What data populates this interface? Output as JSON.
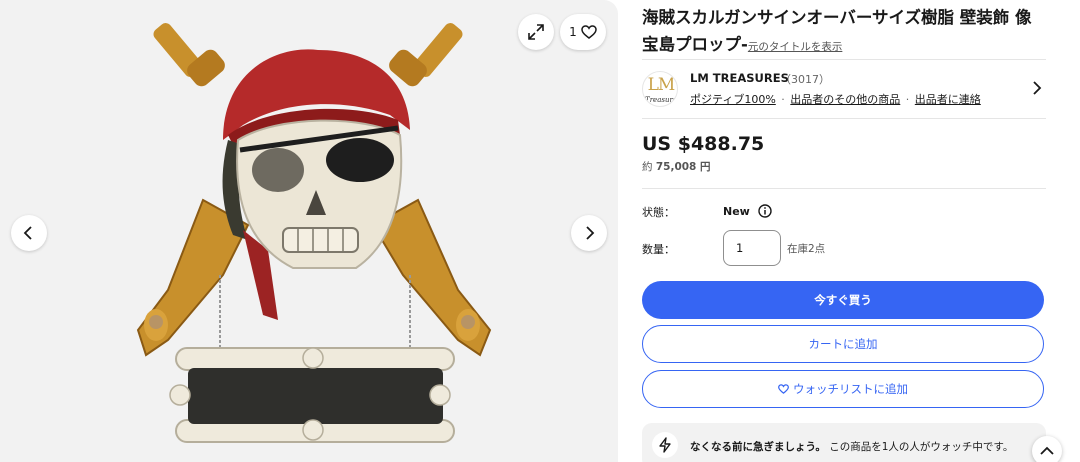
{
  "gallery": {
    "like_count": "1",
    "product_image_icon": "pirate-skull-sign-image"
  },
  "product": {
    "title": "海賊スカルガンサインオーバーサイズ樹脂 壁装飾 像 宝島プロップ-",
    "original_title_link": "元のタイトルを表示"
  },
  "seller": {
    "logo_text": "LM",
    "logo_subtext": "Treasure",
    "name": "LM TREASURES",
    "feedback_count": "（3017）",
    "positive": "ポジティブ100%",
    "other_items": "出品者のその他の商品",
    "contact": "出品者に連絡",
    "separator": "·"
  },
  "pricing": {
    "price": "US $488.75",
    "approx_prefix": "約",
    "approx_value": "75,008 円"
  },
  "condition": {
    "label": "状態：",
    "value": "New"
  },
  "quantity": {
    "label": "数量：",
    "value": "1",
    "stock": "在庫2点"
  },
  "actions": {
    "buy_now": "今すぐ買う",
    "add_to_cart": "カートに追加",
    "add_to_watchlist": "ウォッチリストに追加"
  },
  "urgency": {
    "bold": "なくなる前に急ぎましょう。",
    "text": "この商品を1人の人がウォッチ中です。"
  },
  "colors": {
    "accent": "#3665f3",
    "gallery_bg": "#f2f2f2"
  }
}
